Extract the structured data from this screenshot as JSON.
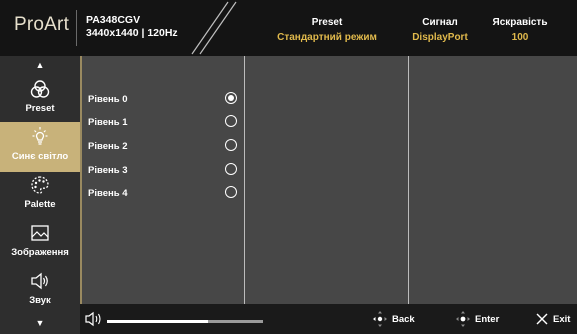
{
  "header": {
    "logo": "ProArt",
    "model": "PA348CGV",
    "resolution": "3440x1440 | 120Hz",
    "preset_label": "Preset",
    "preset_value": "Стандартний режим",
    "signal_label": "Сигнал",
    "signal_value": "DisplayPort",
    "brightness_label": "Яскравість",
    "brightness_value": "100"
  },
  "sidebar": {
    "items": [
      {
        "label": "Preset",
        "icon": "preset-icon",
        "active": false
      },
      {
        "label": "Синє світло",
        "icon": "blue-light-icon",
        "active": true
      },
      {
        "label": "Palette",
        "icon": "palette-icon",
        "active": false
      },
      {
        "label": "Зображення",
        "icon": "image-icon",
        "active": false
      },
      {
        "label": "Звук",
        "icon": "speaker-icon",
        "active": false
      }
    ]
  },
  "options": [
    {
      "label": "Рівень 0",
      "selected": true
    },
    {
      "label": "Рівень 1",
      "selected": false
    },
    {
      "label": "Рівень 2",
      "selected": false
    },
    {
      "label": "Рівень 3",
      "selected": false
    },
    {
      "label": "Рівень 4",
      "selected": false
    }
  ],
  "footer": {
    "volume_level": 0.65,
    "back_label": "Back",
    "enter_label": "Enter",
    "exit_label": "Exit"
  },
  "colors": {
    "accent": "#c8b27a",
    "value_text": "#e0b94c",
    "header_bg": "#141414",
    "sidebar_bg": "#2e2e2e",
    "panel_bg": "#474747"
  }
}
